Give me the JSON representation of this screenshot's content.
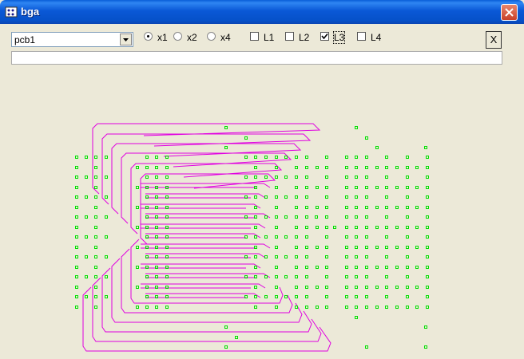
{
  "window": {
    "title": "bga",
    "close_icon": "close-x-icon",
    "app_icon": "bga-app-icon"
  },
  "toolbar": {
    "board_select": {
      "value": "pcb1"
    },
    "zoom_options": [
      {
        "label": "x1",
        "selected": true
      },
      {
        "label": "x2",
        "selected": false
      },
      {
        "label": "x4",
        "selected": false
      }
    ],
    "layers": [
      {
        "label": "L1",
        "checked": false
      },
      {
        "label": "L2",
        "checked": false
      },
      {
        "label": "L3",
        "checked": true,
        "focused": true
      },
      {
        "label": "L4",
        "checked": false
      }
    ],
    "close_label": "X"
  },
  "status": {
    "value": ""
  },
  "colors": {
    "pad": "#00e000",
    "trace": "#e000e0",
    "titlebar": "#0a58d6",
    "background": "#ece9d8"
  }
}
